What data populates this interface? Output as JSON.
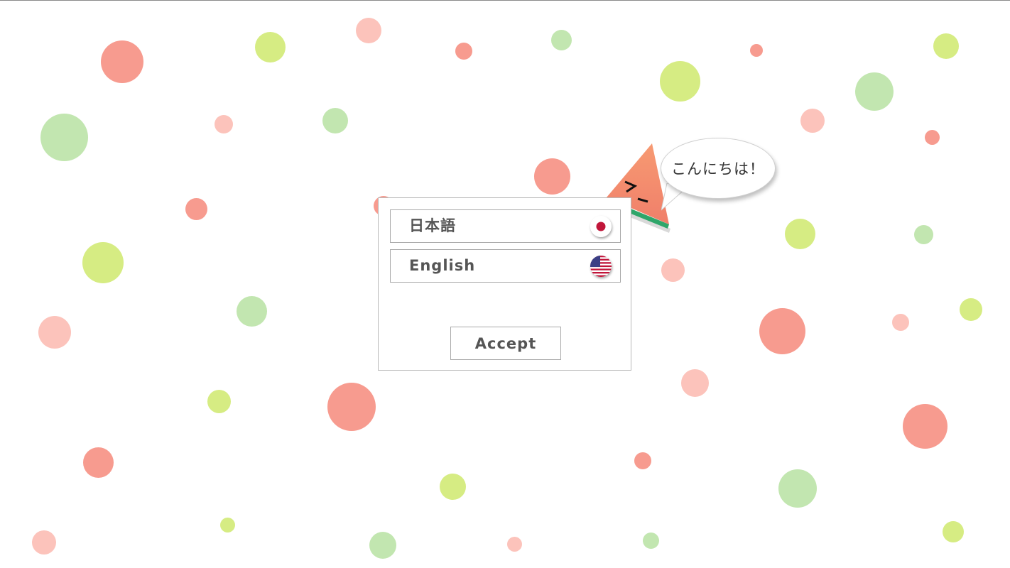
{
  "mascot": {
    "speech": "こんにちは！"
  },
  "dialog": {
    "options": [
      {
        "label": "日本語",
        "flag": "japan-flag-icon"
      },
      {
        "label": "English",
        "flag": "us-flag-icon"
      }
    ],
    "accept_label": "Accept"
  },
  "colors": {
    "dot_red": "#f79b8f",
    "dot_pink": "#fcc3bb",
    "dot_green": "#c2e6b0",
    "dot_lime": "#d6ec83",
    "melon_flesh": "#f5906e",
    "melon_rind": "#2fa66a"
  }
}
